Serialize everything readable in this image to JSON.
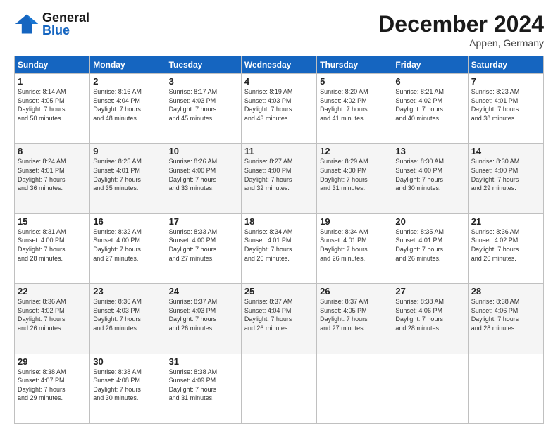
{
  "header": {
    "logo_general": "General",
    "logo_blue": "Blue",
    "month_title": "December 2024",
    "location": "Appen, Germany"
  },
  "days_of_week": [
    "Sunday",
    "Monday",
    "Tuesday",
    "Wednesday",
    "Thursday",
    "Friday",
    "Saturday"
  ],
  "weeks": [
    [
      {
        "day": "1",
        "info": "Sunrise: 8:14 AM\nSunset: 4:05 PM\nDaylight: 7 hours\nand 50 minutes."
      },
      {
        "day": "2",
        "info": "Sunrise: 8:16 AM\nSunset: 4:04 PM\nDaylight: 7 hours\nand 48 minutes."
      },
      {
        "day": "3",
        "info": "Sunrise: 8:17 AM\nSunset: 4:03 PM\nDaylight: 7 hours\nand 45 minutes."
      },
      {
        "day": "4",
        "info": "Sunrise: 8:19 AM\nSunset: 4:03 PM\nDaylight: 7 hours\nand 43 minutes."
      },
      {
        "day": "5",
        "info": "Sunrise: 8:20 AM\nSunset: 4:02 PM\nDaylight: 7 hours\nand 41 minutes."
      },
      {
        "day": "6",
        "info": "Sunrise: 8:21 AM\nSunset: 4:02 PM\nDaylight: 7 hours\nand 40 minutes."
      },
      {
        "day": "7",
        "info": "Sunrise: 8:23 AM\nSunset: 4:01 PM\nDaylight: 7 hours\nand 38 minutes."
      }
    ],
    [
      {
        "day": "8",
        "info": "Sunrise: 8:24 AM\nSunset: 4:01 PM\nDaylight: 7 hours\nand 36 minutes."
      },
      {
        "day": "9",
        "info": "Sunrise: 8:25 AM\nSunset: 4:01 PM\nDaylight: 7 hours\nand 35 minutes."
      },
      {
        "day": "10",
        "info": "Sunrise: 8:26 AM\nSunset: 4:00 PM\nDaylight: 7 hours\nand 33 minutes."
      },
      {
        "day": "11",
        "info": "Sunrise: 8:27 AM\nSunset: 4:00 PM\nDaylight: 7 hours\nand 32 minutes."
      },
      {
        "day": "12",
        "info": "Sunrise: 8:29 AM\nSunset: 4:00 PM\nDaylight: 7 hours\nand 31 minutes."
      },
      {
        "day": "13",
        "info": "Sunrise: 8:30 AM\nSunset: 4:00 PM\nDaylight: 7 hours\nand 30 minutes."
      },
      {
        "day": "14",
        "info": "Sunrise: 8:30 AM\nSunset: 4:00 PM\nDaylight: 7 hours\nand 29 minutes."
      }
    ],
    [
      {
        "day": "15",
        "info": "Sunrise: 8:31 AM\nSunset: 4:00 PM\nDaylight: 7 hours\nand 28 minutes."
      },
      {
        "day": "16",
        "info": "Sunrise: 8:32 AM\nSunset: 4:00 PM\nDaylight: 7 hours\nand 27 minutes."
      },
      {
        "day": "17",
        "info": "Sunrise: 8:33 AM\nSunset: 4:00 PM\nDaylight: 7 hours\nand 27 minutes."
      },
      {
        "day": "18",
        "info": "Sunrise: 8:34 AM\nSunset: 4:01 PM\nDaylight: 7 hours\nand 26 minutes."
      },
      {
        "day": "19",
        "info": "Sunrise: 8:34 AM\nSunset: 4:01 PM\nDaylight: 7 hours\nand 26 minutes."
      },
      {
        "day": "20",
        "info": "Sunrise: 8:35 AM\nSunset: 4:01 PM\nDaylight: 7 hours\nand 26 minutes."
      },
      {
        "day": "21",
        "info": "Sunrise: 8:36 AM\nSunset: 4:02 PM\nDaylight: 7 hours\nand 26 minutes."
      }
    ],
    [
      {
        "day": "22",
        "info": "Sunrise: 8:36 AM\nSunset: 4:02 PM\nDaylight: 7 hours\nand 26 minutes."
      },
      {
        "day": "23",
        "info": "Sunrise: 8:36 AM\nSunset: 4:03 PM\nDaylight: 7 hours\nand 26 minutes."
      },
      {
        "day": "24",
        "info": "Sunrise: 8:37 AM\nSunset: 4:03 PM\nDaylight: 7 hours\nand 26 minutes."
      },
      {
        "day": "25",
        "info": "Sunrise: 8:37 AM\nSunset: 4:04 PM\nDaylight: 7 hours\nand 26 minutes."
      },
      {
        "day": "26",
        "info": "Sunrise: 8:37 AM\nSunset: 4:05 PM\nDaylight: 7 hours\nand 27 minutes."
      },
      {
        "day": "27",
        "info": "Sunrise: 8:38 AM\nSunset: 4:06 PM\nDaylight: 7 hours\nand 28 minutes."
      },
      {
        "day": "28",
        "info": "Sunrise: 8:38 AM\nSunset: 4:06 PM\nDaylight: 7 hours\nand 28 minutes."
      }
    ],
    [
      {
        "day": "29",
        "info": "Sunrise: 8:38 AM\nSunset: 4:07 PM\nDaylight: 7 hours\nand 29 minutes."
      },
      {
        "day": "30",
        "info": "Sunrise: 8:38 AM\nSunset: 4:08 PM\nDaylight: 7 hours\nand 30 minutes."
      },
      {
        "day": "31",
        "info": "Sunrise: 8:38 AM\nSunset: 4:09 PM\nDaylight: 7 hours\nand 31 minutes."
      },
      null,
      null,
      null,
      null
    ]
  ]
}
